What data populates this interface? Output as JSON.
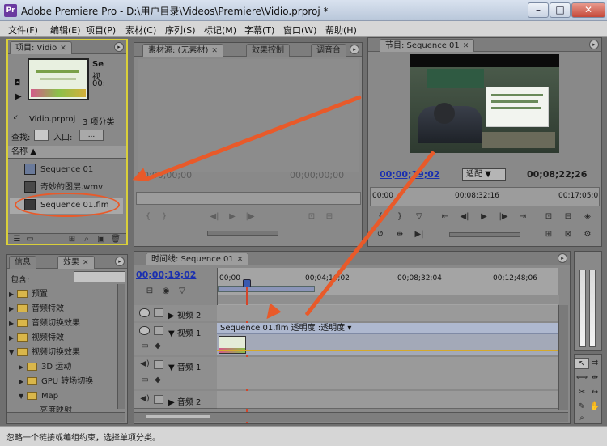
{
  "window": {
    "title": "Adobe Premiere Pro - D:\\用户目录\\Videos\\Premiere\\Vidio.prproj *",
    "app_icon": "Pr",
    "minimize": "–",
    "maximize": "□",
    "close": "✕"
  },
  "menu": [
    "文件(F)",
    "编辑(E)",
    "项目(P)",
    "素材(C)",
    "序列(S)",
    "标记(M)",
    "字幕(T)",
    "窗口(W)",
    "帮助(H)"
  ],
  "project": {
    "tab": "项目: Vidio",
    "clip_name": "Se",
    "clip_line2": "视",
    "clip_line3": "00:",
    "project_file": "Vidio.prproj",
    "item_count": "3 项分类",
    "search_label": "查找:",
    "entry_label": "入口:",
    "entry_value": "...",
    "column_name": "名称",
    "items": [
      "Sequence 01",
      "奇妙的图层.wmv",
      "Sequence 01.flm"
    ]
  },
  "effects": {
    "tab_info": "信息",
    "tab_effects": "效果",
    "contains_label": "包含:",
    "items": [
      {
        "label": "预置",
        "indent": 0
      },
      {
        "label": "音频特效",
        "indent": 0
      },
      {
        "label": "音频切换效果",
        "indent": 0
      },
      {
        "label": "视频特效",
        "indent": 0
      },
      {
        "label": "视频切换效果",
        "indent": 0
      },
      {
        "label": "3D 运动",
        "indent": 1
      },
      {
        "label": "GPU 转场切换",
        "indent": 1
      },
      {
        "label": "Map",
        "indent": 1
      },
      {
        "label": "亮度映射",
        "indent": 2
      }
    ]
  },
  "source_monitor": {
    "tab_source": "素材源: (无素材)",
    "tab_effect_controls": "效果控制",
    "tab_mixer": "调音台",
    "timecode_left": "00;00;00;00",
    "timecode_right": "00;00;00;00"
  },
  "program_monitor": {
    "tab": "节目: Sequence 01",
    "timecode_current": "00;00;19;02",
    "fit_label": "适配",
    "timecode_duration": "00;08;22;26",
    "ruler_ticks": [
      "00;00",
      "00;08;32;16",
      "00;17;05;0"
    ]
  },
  "timeline": {
    "tab": "时间线: Sequence 01",
    "timecode": "00;00;19;02",
    "ruler_ticks": [
      "00;00",
      "00;04;16;02",
      "00;08;32;04",
      "00;12;48;06"
    ],
    "tracks": [
      {
        "name": "视频 2",
        "kind": "video"
      },
      {
        "name": "视频 1",
        "kind": "video"
      },
      {
        "name": "音频 1",
        "kind": "audio"
      },
      {
        "name": "音频 2",
        "kind": "audio"
      }
    ],
    "clip_label": "Sequence 01.flm 透明度 :透明度 ▾"
  },
  "status_text": "忽略一个链接或编组约束，选择单项分类。",
  "colors": {
    "arrow": "#e85a2a",
    "project_highlight": "#d9cf3a",
    "timecode_blue": "#1a2fb0",
    "playhead": "#d4452a"
  },
  "icons": [
    "play-icon",
    "step-back-icon",
    "step-forward-icon",
    "mark-in-icon",
    "mark-out-icon",
    "folder-icon",
    "eye-icon",
    "speaker-icon",
    "selection-tool-icon",
    "razor-tool-icon",
    "hand-tool-icon",
    "zoom-tool-icon"
  ]
}
